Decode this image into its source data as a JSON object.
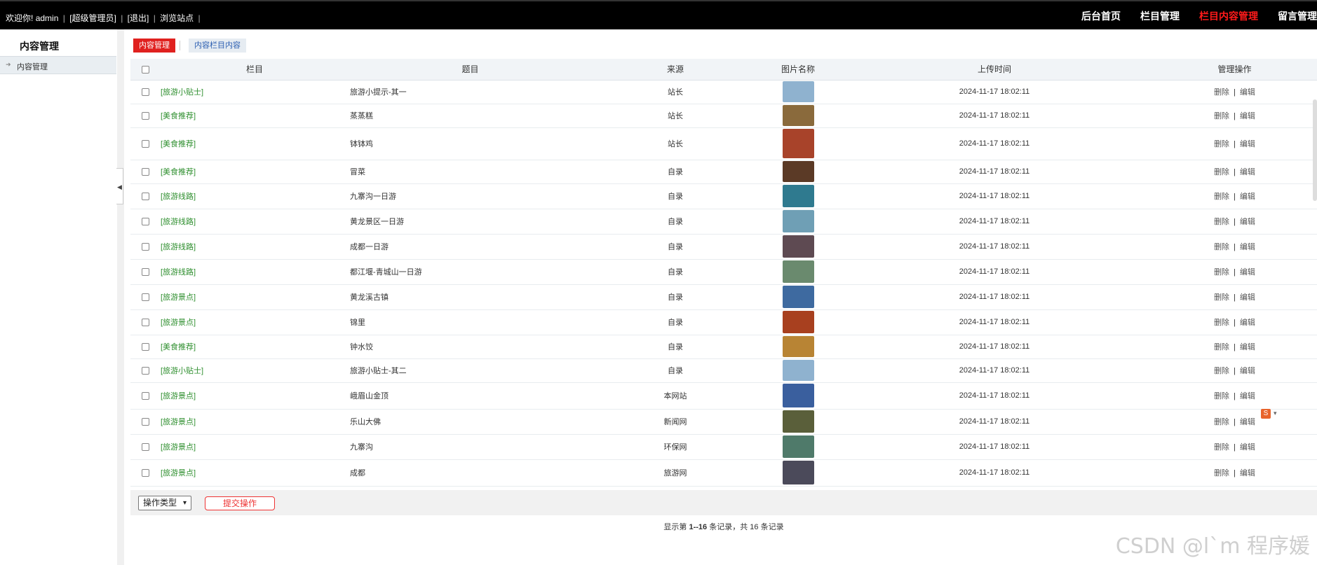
{
  "header": {
    "welcome_prefix": "欢迎你!",
    "user": "admin",
    "role": "[超级管理员]",
    "logout": "[退出]",
    "browse": "浏览站点",
    "nav": [
      {
        "label": "后台首页",
        "active": false
      },
      {
        "label": "栏目管理",
        "active": false
      },
      {
        "label": "栏目内容管理",
        "active": true
      },
      {
        "label": "留言管理",
        "active": false
      }
    ]
  },
  "sidebar": {
    "title": "内容管理",
    "items": [
      {
        "label": "内容管理"
      }
    ]
  },
  "tabs": [
    {
      "label": "内容管理",
      "active": true
    },
    {
      "label": "内容栏目内容",
      "active": false
    }
  ],
  "table": {
    "headers": [
      "栏目",
      "题目",
      "来源",
      "图片名称",
      "上传时间",
      "管理操作"
    ],
    "delete_label": "删除",
    "edit_label": "编辑",
    "rows": [
      {
        "category": "[旅游小贴士]",
        "title": "旅游小提示-其一",
        "source": "站长",
        "time": "2024-11-17 18:02:11",
        "thumb": "#8fb2cf"
      },
      {
        "category": "[美食推荐]",
        "title": "蒸蒸糕",
        "source": "站长",
        "time": "2024-11-17 18:02:11",
        "thumb": "#8a6a3c"
      },
      {
        "category": "[美食推荐]",
        "title": "钵钵鸡",
        "source": "站长",
        "time": "2024-11-17 18:02:11",
        "thumb": "#a8432a"
      },
      {
        "category": "[美食推荐]",
        "title": "冒菜",
        "source": "自录",
        "time": "2024-11-17 18:02:11",
        "thumb": "#5b3a26"
      },
      {
        "category": "[旅游线路]",
        "title": "九寨沟一日游",
        "source": "自录",
        "time": "2024-11-17 18:02:11",
        "thumb": "#2f7a8f"
      },
      {
        "category": "[旅游线路]",
        "title": "黄龙景区一日游",
        "source": "自录",
        "time": "2024-11-17 18:02:11",
        "thumb": "#6f9fb5"
      },
      {
        "category": "[旅游线路]",
        "title": "成都一日游",
        "source": "自录",
        "time": "2024-11-17 18:02:11",
        "thumb": "#5e4a52"
      },
      {
        "category": "[旅游线路]",
        "title": "都江堰-青城山一日游",
        "source": "自录",
        "time": "2024-11-17 18:02:11",
        "thumb": "#6a8a6e"
      },
      {
        "category": "[旅游景点]",
        "title": "黄龙溪古镇",
        "source": "自录",
        "time": "2024-11-17 18:02:11",
        "thumb": "#3e6aa0"
      },
      {
        "category": "[旅游景点]",
        "title": "锦里",
        "source": "自录",
        "time": "2024-11-17 18:02:11",
        "thumb": "#a8401f"
      },
      {
        "category": "[美食推荐]",
        "title": "钟水饺",
        "source": "自录",
        "time": "2024-11-17 18:02:11",
        "thumb": "#b88434"
      },
      {
        "category": "[旅游小贴士]",
        "title": "旅游小贴士-其二",
        "source": "自录",
        "time": "2024-11-17 18:02:11",
        "thumb": "#8fb2cf"
      },
      {
        "category": "[旅游景点]",
        "title": "峨眉山金顶",
        "source": "本网站",
        "time": "2024-11-17 18:02:11",
        "thumb": "#3a5f9e"
      },
      {
        "category": "[旅游景点]",
        "title": "乐山大佛",
        "source": "新闻网",
        "time": "2024-11-17 18:02:11",
        "thumb": "#5a5f3a"
      },
      {
        "category": "[旅游景点]",
        "title": "九寨沟",
        "source": "环保网",
        "time": "2024-11-17 18:02:11",
        "thumb": "#4f7a6a"
      },
      {
        "category": "[旅游景点]",
        "title": "成都",
        "source": "旅游网",
        "time": "2024-11-17 18:02:11",
        "thumb": "#4b4a5a"
      }
    ]
  },
  "footer": {
    "select_label": "操作类型",
    "submit_label": "提交操作"
  },
  "pager": {
    "prefix": "显示第",
    "range": "1--16",
    "mid": "条记录，共",
    "total": "16",
    "suffix": "条记录"
  },
  "watermark": "CSDN @l`m 程序媛"
}
